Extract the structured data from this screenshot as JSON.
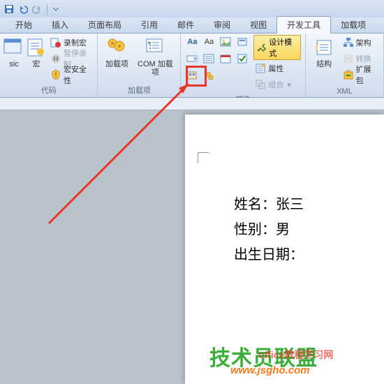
{
  "tabs": {
    "start": "开始",
    "insert": "插入",
    "layout": "页面布局",
    "references": "引用",
    "mail": "邮件",
    "review": "审阅",
    "view": "视图",
    "dev": "开发工具",
    "addins": "加载项"
  },
  "code": {
    "basic": "sic",
    "macro": "宏",
    "record": "录制宏",
    "pause": "暂停录制",
    "security": "宏安全性",
    "label": "代码"
  },
  "addins_group": {
    "addins": "加载项",
    "com": "COM 加载项",
    "label": "加载项"
  },
  "controls": {
    "aa1": "Aa",
    "aa2": "Aa",
    "design": "设计模式",
    "properties": "属性",
    "group": "组合",
    "label": "控件"
  },
  "xml": {
    "structure": "结构",
    "schema": "架构",
    "transform": "转换",
    "expand": "扩展包",
    "label": "XML"
  },
  "doc": {
    "name_label": "姓名：",
    "name_value": "张三",
    "gender_label": "性别：",
    "gender_value": "男",
    "dob_label": "出生日期："
  },
  "watermark": {
    "brand": "技术员联盟",
    "small": "office教程学习网",
    "url": "www.jsgho.com"
  }
}
